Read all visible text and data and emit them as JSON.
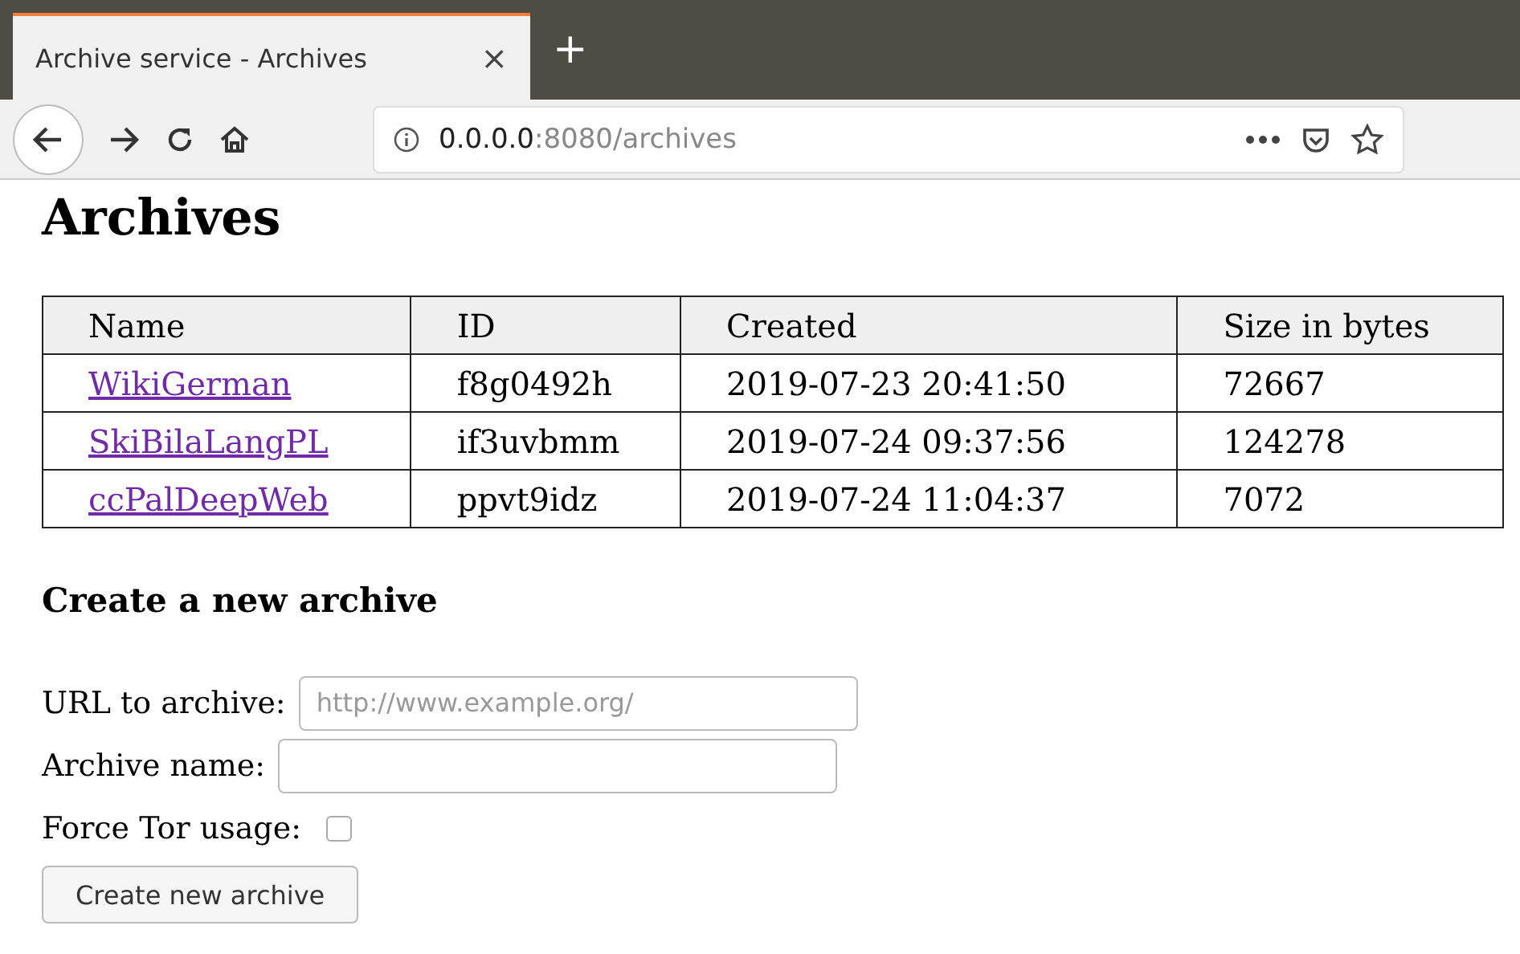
{
  "browser": {
    "tab": {
      "title": "Archive service - Archives",
      "close": "×"
    },
    "new_tab": "+",
    "url": {
      "host": "0.0.0.0",
      "rest": ":8080/archives"
    }
  },
  "heading": "Archives",
  "table": {
    "columns": [
      "Name",
      "ID",
      "Created",
      "Size in bytes"
    ],
    "rows": [
      [
        "WikiGerman",
        "f8g0492h",
        "2019-07-23 20:41:50",
        "72667"
      ],
      [
        "SkiBilaLangPL",
        "if3uvbmm",
        "2019-07-24 09:37:56",
        "124278"
      ],
      [
        "ccPalDeepWeb",
        "ppvt9idz",
        "2019-07-24 11:04:37",
        "7072"
      ]
    ]
  },
  "form": {
    "title": "Create a new archive",
    "url_label": "URL to archive:",
    "url_placeholder": "http://www.example.org/",
    "name_label": "Archive name:",
    "tor_label": "Force Tor usage:",
    "tor_checked": false,
    "submit": "Create new archive"
  }
}
